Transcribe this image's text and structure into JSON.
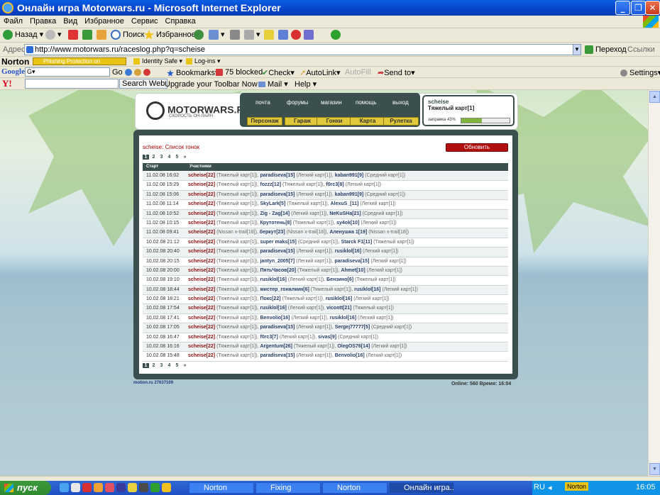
{
  "window": {
    "title": "Онлайн игра Motorwars.ru - Microsoft Internet Explorer"
  },
  "menu": [
    "Файл",
    "Правка",
    "Вид",
    "Избранное",
    "Сервис",
    "Справка"
  ],
  "toolbar": {
    "back": "Назад",
    "search": "Поиск",
    "favorites": "Избранное"
  },
  "address": {
    "label": "Адрес:",
    "url": "http://www.motorwars.ru/raceslog.php?q=scheise",
    "go": "Переход",
    "links": "Ссылки"
  },
  "norton": {
    "brand": "Norton",
    "phishing": "Phishing Protection on",
    "identity": "Identity Safe",
    "login": "Log-ins"
  },
  "google": {
    "brand": "Google",
    "go": "Go",
    "bookmarks": "Bookmarks",
    "blocked": "75 blocked",
    "check": "Check",
    "autolink": "AutoLink",
    "autofill": "AutoFill",
    "sendto": "Send to",
    "settings": "Settings"
  },
  "yahoo": {
    "brand": "Y!",
    "search": "Search Web",
    "upgrade": "Upgrade your Toolbar Now",
    "mail": "Mail",
    "help": "Help"
  },
  "site": {
    "logo": "MOTORWARS.RU",
    "tagline": "СКОРОСТЬ ОН-ЛАЙН",
    "nav_top": [
      "почта",
      "форумы",
      "магазин",
      "помощь",
      "выход"
    ],
    "nav_bottom": [
      "Персонаж",
      "Гараж",
      "Гонки",
      "Карта",
      "Рулетка"
    ],
    "user": {
      "name": "scheise",
      "car": "Тяжелый карт[1]",
      "fuel_label": "заправка 43%",
      "fuel_percent": 43
    },
    "caption": "scheise: Список гонок",
    "refresh": "Обновить",
    "pages": [
      "1",
      "2",
      "3",
      "4",
      "5",
      "»"
    ],
    "columns": [
      "Старт",
      "Участники"
    ],
    "races": [
      {
        "time": "11.02.08 16:02",
        "p": [
          [
            "scheise[22]",
            "Тяжелый карт[1]"
          ],
          [
            "paradiseva[15]",
            "Легкий карт[1]"
          ],
          [
            "kaban991[9]",
            "Средний карт[1]"
          ]
        ]
      },
      {
        "time": "11.02.08 15:29",
        "p": [
          [
            "scheise[22]",
            "Тяжелый карт[1]"
          ],
          [
            "fozzz[12]",
            "Тяжелый карт[1]"
          ],
          [
            "f0rc3[8]",
            "Легкий карт[1]"
          ]
        ]
      },
      {
        "time": "11.02.08 15:06",
        "p": [
          [
            "scheise[22]",
            "Тяжелый карт[1]"
          ],
          [
            "paradiseva[15]",
            "Легкий карт[1]"
          ],
          [
            "kaban991[9]",
            "Средний карт[1]"
          ]
        ]
      },
      {
        "time": "11.02.08 11:14",
        "p": [
          [
            "scheise[22]",
            "Тяжелый карт[1]"
          ],
          [
            "SkyLark[5]",
            "Тяжелый карт[1]"
          ],
          [
            "AlexuS_[11]",
            "Легкий карт[1]"
          ]
        ]
      },
      {
        "time": "11.02.08 10:52",
        "p": [
          [
            "scheise[22]",
            "Тяжелый карт[1]"
          ],
          [
            "Zig - Zag[14]",
            "Легкий карт[1]"
          ],
          [
            "NeKuSHa[21]",
            "Средний карт[1]"
          ]
        ]
      },
      {
        "time": "11.02.08 10:15",
        "p": [
          [
            "scheise[22]",
            "Тяжелый карт[1]"
          ],
          [
            "Крутотень[8]",
            "Тяжелый карт[1]"
          ],
          [
            "sy4ok[10]",
            "Легкий карт[1]"
          ]
        ]
      },
      {
        "time": "11.02.08 09:41",
        "p": [
          [
            "scheise[22]",
            "Nissan x-trail[18]"
          ],
          [
            "беркут[23]",
            "Nissan x-trail[18]"
          ],
          [
            "Аленушка 1[19]",
            "Nissan x-trail[18]"
          ]
        ]
      },
      {
        "time": "10.02.08 21:12",
        "p": [
          [
            "scheise[22]",
            "Тяжелый карт[1]"
          ],
          [
            "super maks[15]",
            "Средний карт[1]"
          ],
          [
            "Starck F1[11]",
            "Тяжелый карт[1]"
          ]
        ]
      },
      {
        "time": "10.02.08 20:40",
        "p": [
          [
            "scheise[22]",
            "Тяжелый карт[1]"
          ],
          [
            "paradiseva[15]",
            "Легкий карт[1]"
          ],
          [
            "rusiklol[16]",
            "Легкий карт[1]"
          ]
        ]
      },
      {
        "time": "10.02.08 20:15",
        "p": [
          [
            "scheise[22]",
            "Тяжелый карт[1]"
          ],
          [
            "jantyn_2005[7]",
            "Легкий карт[1]"
          ],
          [
            "paradiseva[15]",
            "Легкий карт[1]"
          ]
        ]
      },
      {
        "time": "10.02.08 20:00",
        "p": [
          [
            "scheise[22]",
            "Тяжелый карт[1]"
          ],
          [
            "ПятьЧасов[20]",
            "Тяжелый карт[1]"
          ],
          [
            "Ahmet[10]",
            "Легкий карт[1]"
          ]
        ]
      },
      {
        "time": "10.02.08 19:10",
        "p": [
          [
            "scheise[22]",
            "Тяжелый карт[1]"
          ],
          [
            "rusiklol[16]",
            "Легкий карт[1]"
          ],
          [
            "Бензино[6]",
            "Тяжелый карт[1]"
          ]
        ]
      },
      {
        "time": "10.02.08 18:44",
        "p": [
          [
            "scheise[22]",
            "Тяжелый карт[1]"
          ],
          [
            "мистер_гонялкин[6]",
            "Тяжелый карт[1]"
          ],
          [
            "rusiklol[16]",
            "Легкий карт[1]"
          ]
        ]
      },
      {
        "time": "10.02.08 18:21",
        "p": [
          [
            "scheise[22]",
            "Тяжелый карт[1]"
          ],
          [
            "Покс[22]",
            "Тяжелый карт[1]"
          ],
          [
            "rusiklol[16]",
            "Легкий карт[1]"
          ]
        ]
      },
      {
        "time": "10.02.08 17:54",
        "p": [
          [
            "scheise[22]",
            "Тяжелый карт[1]"
          ],
          [
            "rusiklol[16]",
            "Легкий карт[1]"
          ],
          [
            "vicontt[21]",
            "Тяжелый карт[1]"
          ]
        ]
      },
      {
        "time": "10.02.08 17:41",
        "p": [
          [
            "scheise[22]",
            "Тяжелый карт[1]"
          ],
          [
            "Benvolio[16]",
            "Легкий карт[1]"
          ],
          [
            "rusiklol[16]",
            "Легкий карт[1]"
          ]
        ]
      },
      {
        "time": "10.02.08 17:05",
        "p": [
          [
            "scheise[22]",
            "Тяжелый карт[1]"
          ],
          [
            "paradiseva[15]",
            "Легкий карт[1]"
          ],
          [
            "Sergej77777[5]",
            "Средний карт[1]"
          ]
        ]
      },
      {
        "time": "10.02.08 16:47",
        "p": [
          [
            "scheise[22]",
            "Тяжелый карт[1]"
          ],
          [
            "f0rc3[7]",
            "Легкий карт[1]"
          ],
          [
            "sivas[9]",
            "Средний карт[1]"
          ]
        ]
      },
      {
        "time": "10.02.08 16:16",
        "p": [
          [
            "scheise[22]",
            "Тяжелый карт[1]"
          ],
          [
            "Argentum[26]",
            "Тяжелый карт[1]"
          ],
          [
            "OlegOS76[14]",
            "Легкий карт[1]"
          ]
        ]
      },
      {
        "time": "10.02.08 15:48",
        "p": [
          [
            "scheise[22]",
            "Тяжелый карт[1]"
          ],
          [
            "paradiseva[15]",
            "Легкий карт[1]"
          ],
          [
            "Benvolio[16]",
            "Легкий карт[1]"
          ]
        ]
      }
    ],
    "counter": "27637109",
    "online": "Online: 560  Время: 16:04"
  },
  "taskbar": {
    "start": "пуск",
    "items": [
      "Norton",
      "Fixing",
      "Norton",
      "Онлайн игра..."
    ],
    "lang": "RU",
    "clock": "16:05"
  }
}
